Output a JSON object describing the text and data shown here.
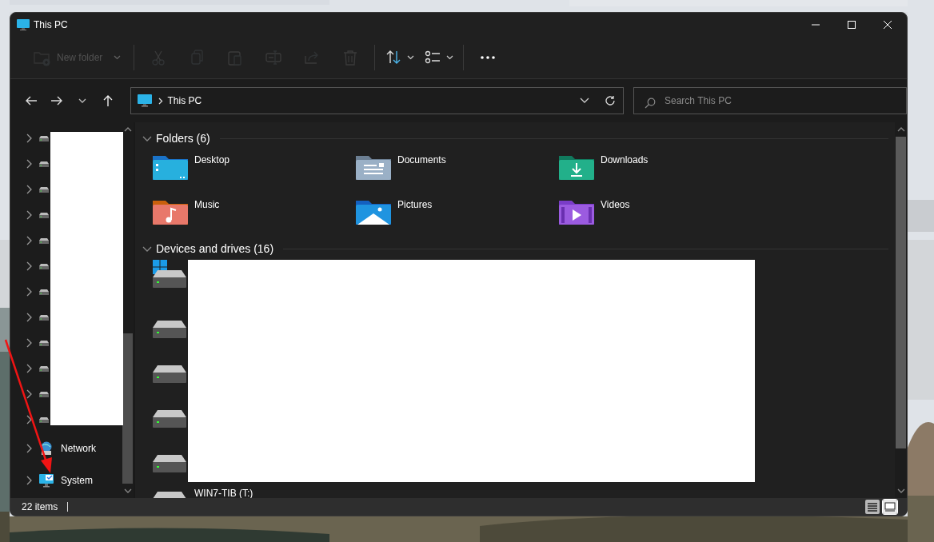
{
  "window": {
    "title": "This PC"
  },
  "toolbar": [
    {
      "kind": "new-folder",
      "label": "New folder",
      "disabled": true
    },
    {
      "kind": "cut",
      "disabled": true
    },
    {
      "kind": "copy",
      "disabled": true
    },
    {
      "kind": "paste",
      "disabled": true
    },
    {
      "kind": "rename",
      "disabled": true
    },
    {
      "kind": "share",
      "disabled": true
    },
    {
      "kind": "delete",
      "disabled": true
    },
    {
      "kind": "sort",
      "disabled": false
    },
    {
      "kind": "view",
      "disabled": false
    },
    {
      "kind": "more",
      "disabled": false
    }
  ],
  "address": {
    "location": "This PC"
  },
  "search": {
    "placeholder": "Search This PC"
  },
  "sidebar": {
    "items": [
      {
        "kind": "drive",
        "expanded": false
      },
      {
        "kind": "drive",
        "expanded": false
      },
      {
        "kind": "drive",
        "expanded": false
      },
      {
        "kind": "drive",
        "expanded": false
      },
      {
        "kind": "drive",
        "expanded": false
      },
      {
        "kind": "drive",
        "expanded": false
      },
      {
        "kind": "drive",
        "expanded": false
      },
      {
        "kind": "drive",
        "expanded": false
      },
      {
        "kind": "drive",
        "expanded": false
      },
      {
        "kind": "drive",
        "expanded": false
      },
      {
        "kind": "drive",
        "expanded": false
      },
      {
        "kind": "drive",
        "expanded": false
      },
      {
        "kind": "network",
        "label": "Network",
        "expanded": false
      },
      {
        "kind": "system",
        "label": "System",
        "expanded": false
      }
    ]
  },
  "sections": [
    {
      "title": "Folders (6)",
      "expanded": true,
      "items": [
        {
          "kind": "desktop",
          "label": "Desktop"
        },
        {
          "kind": "documents",
          "label": "Documents"
        },
        {
          "kind": "downloads",
          "label": "Downloads"
        },
        {
          "kind": "music",
          "label": "Music"
        },
        {
          "kind": "pictures",
          "label": "Pictures"
        },
        {
          "kind": "videos",
          "label": "Videos"
        }
      ]
    },
    {
      "title": "Devices and drives (16)",
      "expanded": true,
      "items": [
        {
          "kind": "system-drive"
        },
        {
          "kind": "drive"
        },
        {
          "kind": "drive"
        },
        {
          "kind": "drive"
        },
        {
          "kind": "drive"
        },
        {
          "kind": "drive",
          "label": "WIN7-TIB (T:)"
        }
      ]
    }
  ],
  "status_bar": {
    "text": "22 items"
  },
  "view_buttons": [
    {
      "kind": "details",
      "selected": false
    },
    {
      "kind": "large-icons",
      "selected": true
    }
  ]
}
